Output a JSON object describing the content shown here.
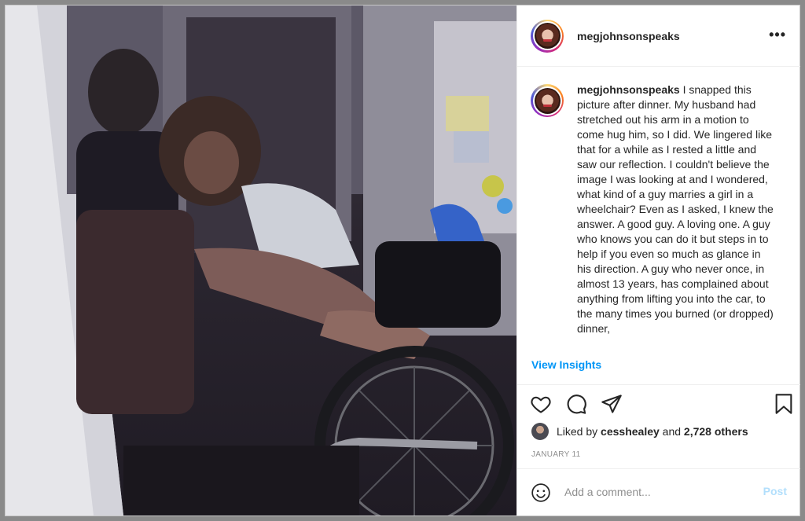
{
  "post": {
    "username": "megjohnsonspeaks",
    "more_label": "•••",
    "caption": "I snapped this picture after dinner. My husband had stretched out his arm in a motion to come hug him, so I did. We lingered like that for a while as I rested a little and saw our reflection. I couldn't believe the image I was looking at and I wondered, what kind of a guy marries a girl in a wheelchair? Even as I asked, I knew the answer. A good guy. A loving one. A guy who knows you can do it but steps in to help if you even so much as glance in his direction. A guy who never once, in almost 13 years, has complained about anything from lifting you into the car, to the many times you burned (or dropped) dinner,",
    "view_insights": "View Insights",
    "likes": {
      "prefix": "Liked by",
      "liker": "cesshealey",
      "middle": "and",
      "count": "2,728 others"
    },
    "date": "JANUARY 11",
    "comment_placeholder": "Add a comment...",
    "post_label": "Post"
  },
  "icons": {
    "more": "more-options-icon",
    "like": "heart-icon",
    "comment": "comment-icon",
    "share": "paper-plane-icon",
    "save": "bookmark-icon",
    "emoji": "smiley-icon"
  },
  "colors": {
    "link": "#0095f6",
    "text": "#262626",
    "muted": "#8e8e8e",
    "post_disabled": "#b2dffc"
  }
}
